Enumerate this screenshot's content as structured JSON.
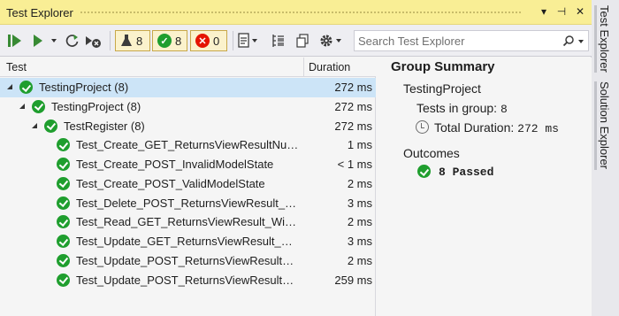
{
  "window": {
    "title": "Test Explorer",
    "controls": {
      "dropdown": "▾",
      "pin": "⊣",
      "close": "✕"
    }
  },
  "toolbar": {
    "counters": {
      "total": "8",
      "passed": "8",
      "failed": "0"
    },
    "search_placeholder": "Search Test Explorer",
    "icons": [
      "run-all-icon",
      "run-icon",
      "repeat-icon",
      "cancel-icon",
      "flask-icon",
      "playlist-icon",
      "group-by-icon",
      "copy-icon",
      "settings-icon",
      "search-icon"
    ]
  },
  "columns": {
    "test": "Test",
    "duration": "Duration"
  },
  "tree": [
    {
      "name": "TestingProject (8)",
      "duration": "272 ms",
      "level": 0,
      "expander": true,
      "selected": true
    },
    {
      "name": "TestingProject (8)",
      "duration": "272 ms",
      "level": 1,
      "expander": true,
      "selected": false
    },
    {
      "name": "TestRegister (8)",
      "duration": "272 ms",
      "level": 2,
      "expander": true,
      "selected": false
    },
    {
      "name": "Test_Create_GET_ReturnsViewResultNullMo...",
      "duration": "1 ms",
      "level": 3,
      "expander": false,
      "selected": false
    },
    {
      "name": "Test_Create_POST_InvalidModelState",
      "duration": "< 1 ms",
      "level": 3,
      "expander": false,
      "selected": false
    },
    {
      "name": "Test_Create_POST_ValidModelState",
      "duration": "2 ms",
      "level": 3,
      "expander": false,
      "selected": false
    },
    {
      "name": "Test_Delete_POST_ReturnsViewResult_InVali...",
      "duration": "3 ms",
      "level": 3,
      "expander": false,
      "selected": false
    },
    {
      "name": "Test_Read_GET_ReturnsViewResult_WithALi...",
      "duration": "2 ms",
      "level": 3,
      "expander": false,
      "selected": false
    },
    {
      "name": "Test_Update_GET_ReturnsViewResult_WithS...",
      "duration": "3 ms",
      "level": 3,
      "expander": false,
      "selected": false
    },
    {
      "name": "Test_Update_POST_ReturnsViewResult_InVa...",
      "duration": "2 ms",
      "level": 3,
      "expander": false,
      "selected": false
    },
    {
      "name": "Test_Update_POST_ReturnsViewResult_Vali...",
      "duration": "259 ms",
      "level": 3,
      "expander": false,
      "selected": false
    }
  ],
  "summary": {
    "heading": "Group Summary",
    "project": "TestingProject",
    "tests_label": "Tests in group:",
    "tests_value": "8",
    "duration_label": "Total Duration:",
    "duration_value": "272 ms",
    "outcomes_label": "Outcomes",
    "passed_text": "8 Passed"
  },
  "side_tabs": [
    "Test Explorer",
    "Solution Explorer"
  ],
  "colors": {
    "title_bar": "#f9ee95",
    "passed": "#1f9e2e",
    "failed": "#e51400",
    "selected_row": "#cce4f7"
  }
}
